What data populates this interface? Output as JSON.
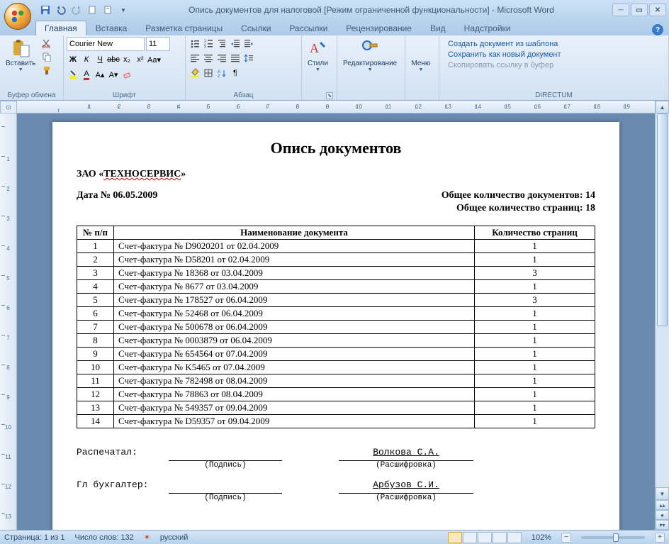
{
  "window": {
    "title": "Опись документов для налоговой [Режим ограниченной функциональности] - Microsoft Word"
  },
  "ribbon": {
    "tabs": [
      "Главная",
      "Вставка",
      "Разметка страницы",
      "Ссылки",
      "Рассылки",
      "Рецензирование",
      "Вид",
      "Надстройки"
    ],
    "active_tab": 0,
    "groups": {
      "clipboard": {
        "label": "Буфер обмена",
        "paste": "Вставить"
      },
      "font": {
        "label": "Шрифт",
        "name": "Courier New",
        "size": "11"
      },
      "paragraph": {
        "label": "Абзац"
      },
      "styles": {
        "label": "Стили"
      },
      "editing": {
        "label": "Редактирование"
      },
      "menu": {
        "label": "Меню"
      },
      "directum": {
        "label": "DIRECTUM",
        "links": [
          "Создать документ из шаблона",
          "Сохранить как новый документ",
          "Скопировать ссылку в буфер"
        ]
      }
    }
  },
  "document": {
    "title": "Опись документов",
    "org_prefix": "ЗАО «",
    "org_name": "ТЕХНОСЕРВИС",
    "org_suffix": "»",
    "date_label": "Дата № 06.05.2009",
    "total_docs": "Общее количество документов: 14",
    "total_pages": "Общее количество страниц: 18",
    "headers": {
      "num": "№ п/п",
      "name": "Наименование документа",
      "pages": "Количество страниц"
    },
    "rows": [
      {
        "n": "1",
        "name": "Счет-фактура № D9020201 от 02.04.2009",
        "p": "1"
      },
      {
        "n": "2",
        "name": "Счет-фактура № D58201 от 02.04.2009",
        "p": "1"
      },
      {
        "n": "3",
        "name": "Счет-фактура № 18368 от 03.04.2009",
        "p": "3"
      },
      {
        "n": "4",
        "name": "Счет-фактура № 8677 от 03.04.2009",
        "p": "1"
      },
      {
        "n": "5",
        "name": "Счет-фактура № 178527 от 06.04.2009",
        "p": "3"
      },
      {
        "n": "6",
        "name": "Счет-фактура № 52468 от 06.04.2009",
        "p": "1"
      },
      {
        "n": "7",
        "name": "Счет-фактура № 500678 от 06.04.2009",
        "p": "1"
      },
      {
        "n": "8",
        "name": "Счет-фактура № 0003879 от 06.04.2009",
        "p": "1"
      },
      {
        "n": "9",
        "name": "Счет-фактура № 654564 от 07.04.2009",
        "p": "1"
      },
      {
        "n": "10",
        "name": "Счет-фактура № K5465 от 07.04.2009",
        "p": "1"
      },
      {
        "n": "11",
        "name": "Счет-фактура № 782498 от 08.04.2009",
        "p": "1"
      },
      {
        "n": "12",
        "name": "Счет-фактура № 78863 от 08.04.2009",
        "p": "1"
      },
      {
        "n": "13",
        "name": "Счет-фактура № 549357 от 09.04.2009",
        "p": "1"
      },
      {
        "n": "14",
        "name": "Счет-фактура № D59357 от 09.04.2009",
        "p": "1"
      }
    ],
    "sig": {
      "printed_label": "Распечатал:",
      "accountant_label": "Гл бухгалтер:",
      "signature_caption": "(Подпись)",
      "decipher_caption": "(Расшифровка)",
      "printed_name": "Волкова С.А.",
      "accountant_name": "Арбузов С.И."
    }
  },
  "status": {
    "page": "Страница: 1 из 1",
    "words": "Число слов: 132",
    "lang": "русский",
    "zoom": "102%"
  },
  "ruler_marks": [
    "",
    "1",
    "2",
    "3",
    "4",
    "5",
    "6",
    "7",
    "8",
    "9",
    "10",
    "11",
    "12",
    "13",
    "14",
    "15",
    "16",
    "17",
    "18",
    "19"
  ],
  "vruler_marks": [
    "",
    "1",
    "2",
    "3",
    "4",
    "5",
    "6",
    "7",
    "8",
    "9",
    "10",
    "11",
    "12",
    "13"
  ]
}
